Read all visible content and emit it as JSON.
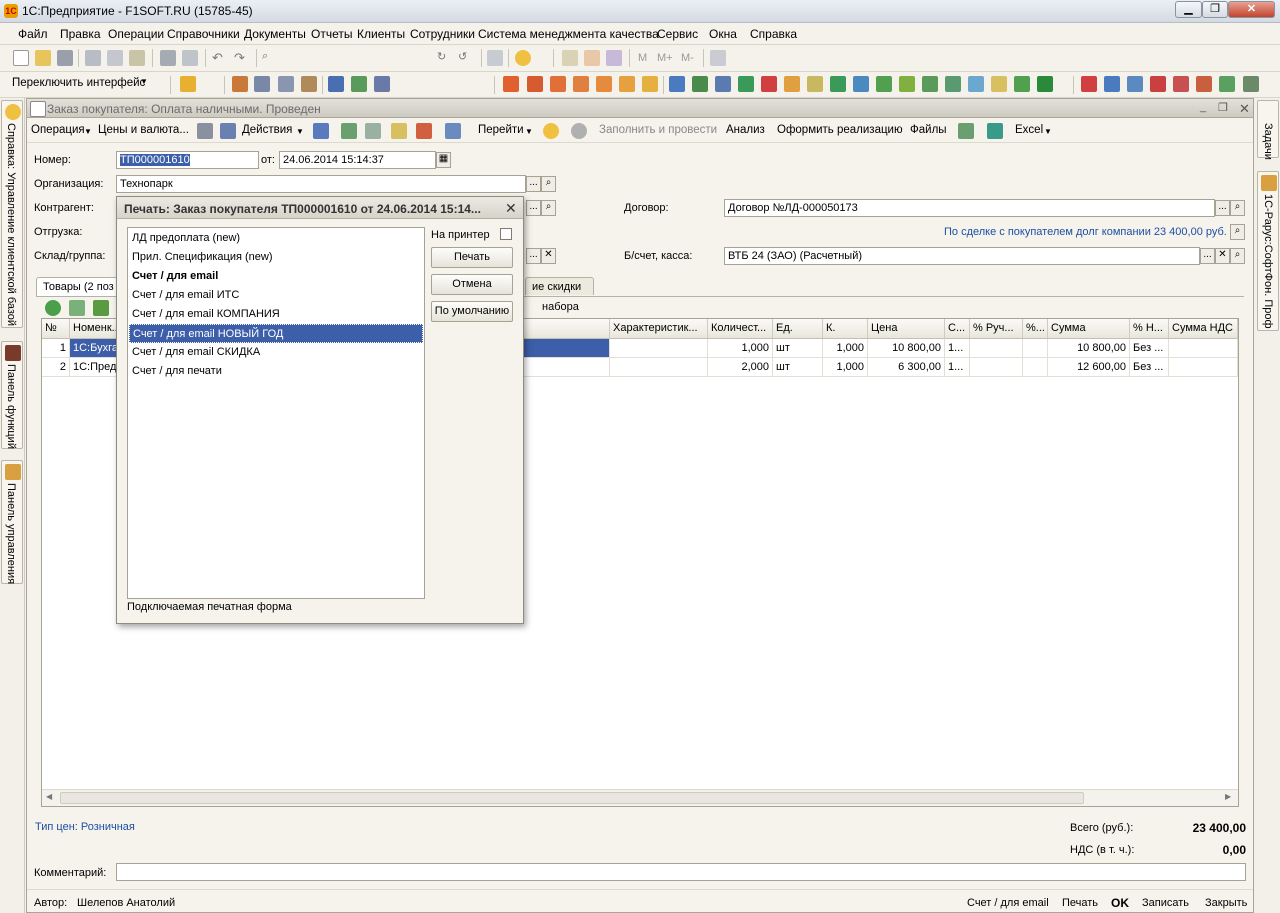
{
  "window": {
    "title": "1С:Предприятие - F1SOFT.RU (15785-45)",
    "min": "▁",
    "restore": "❐",
    "close": "✕"
  },
  "menu": [
    "Файл",
    "Правка",
    "Операции",
    "Справочники",
    "Документы",
    "Отчеты",
    "Клиенты",
    "Сотрудники",
    "Система менеджмента качества",
    "Сервис",
    "Окна",
    "Справка"
  ],
  "toolbar": {
    "calc_m": "М",
    "calc_mplus": "М+",
    "calc_mminus": "М-",
    "switch_interface": "Переключить интерфейс"
  },
  "sidebar_left": [
    "Справка: Управление клиентской базой",
    "Панель функций",
    "Панель управления"
  ],
  "sidebar_right": [
    "Задачи",
    "1С-Рарус:СофтФон. Проф"
  ],
  "document": {
    "title": "Заказ покупателя: Оплата наличными. Проведен",
    "toolbar": [
      "Операция",
      "Цены и валюта...",
      "Действия",
      "Перейти",
      "Заполнить и провести",
      "Анализ",
      "Оформить реализацию",
      "Файлы",
      "Excel"
    ],
    "number_label": "Номер:",
    "number": "ТП000001610",
    "date_label": "от:",
    "date": "24.06.2014 15:14:37",
    "org_label": "Организация:",
    "org": "Технопарк",
    "contractor_label": "Контрагент:",
    "shipment_label": "Отгрузка:",
    "warehouse_label": "Склад/группа:",
    "contract_label": "Договор:",
    "contract": "Договор №ЛД-000050173",
    "debt_note": "По сделке с покупателем долг компании 23 400,00 руб.",
    "account_label": "Б/счет, касса:",
    "account": "ВТБ 24 (ЗАО) (Расчетный)",
    "tabs": [
      "Товары (2 поз",
      "ие скидки"
    ],
    "subset_label": "набора",
    "grid": {
      "headers": [
        "№",
        "Номенк...",
        "Характеристик...",
        "Количест...",
        "Ед.",
        "К.",
        "Цена",
        "С...",
        "% Руч...",
        "%...",
        "Сумма",
        "% Н...",
        "Сумма НДС"
      ],
      "rows": [
        [
          "1",
          "1С:Бухга",
          "",
          "1,000",
          "шт",
          "1,000",
          "10 800,00",
          "1...",
          "",
          "",
          "10 800,00",
          "Без ...",
          ""
        ],
        [
          "2",
          "1С:Пред",
          "",
          "2,000",
          "шт",
          "1,000",
          "6 300,00",
          "1...",
          "",
          "",
          "12 600,00",
          "Без ...",
          ""
        ]
      ]
    },
    "price_type": "Тип цен: Розничная",
    "total_label": "Всего (руб.):",
    "total": "23 400,00",
    "vat_label": "НДС (в т. ч.):",
    "vat": "0,00",
    "comment_label": "Комментарий:",
    "author_label": "Автор:",
    "author": "Шелепов Анатолий",
    "bottom_buttons": [
      "Счет / для email",
      "Печать",
      "OK",
      "Записать",
      "Закрыть"
    ]
  },
  "dialog": {
    "title": "Печать: Заказ покупателя ТП000001610 от 24.06.2014 15:14...",
    "items": [
      "ЛД предоплата (new)",
      "Прил. Спецификация (new)",
      "Счет / для email",
      "Счет / для email ИТС",
      "Счет / для email КОМПАНИЯ",
      "Счет / для email НОВЫЙ ГОД",
      "Счет / для email СКИДКА",
      "Счет / для печати"
    ],
    "selected_index": 5,
    "bold_index": 2,
    "printer_label": "На принтер",
    "print": "Печать",
    "cancel": "Отмена",
    "default": "По умолчанию",
    "footer": "Подключаемая печатная форма",
    "close": "✕"
  }
}
